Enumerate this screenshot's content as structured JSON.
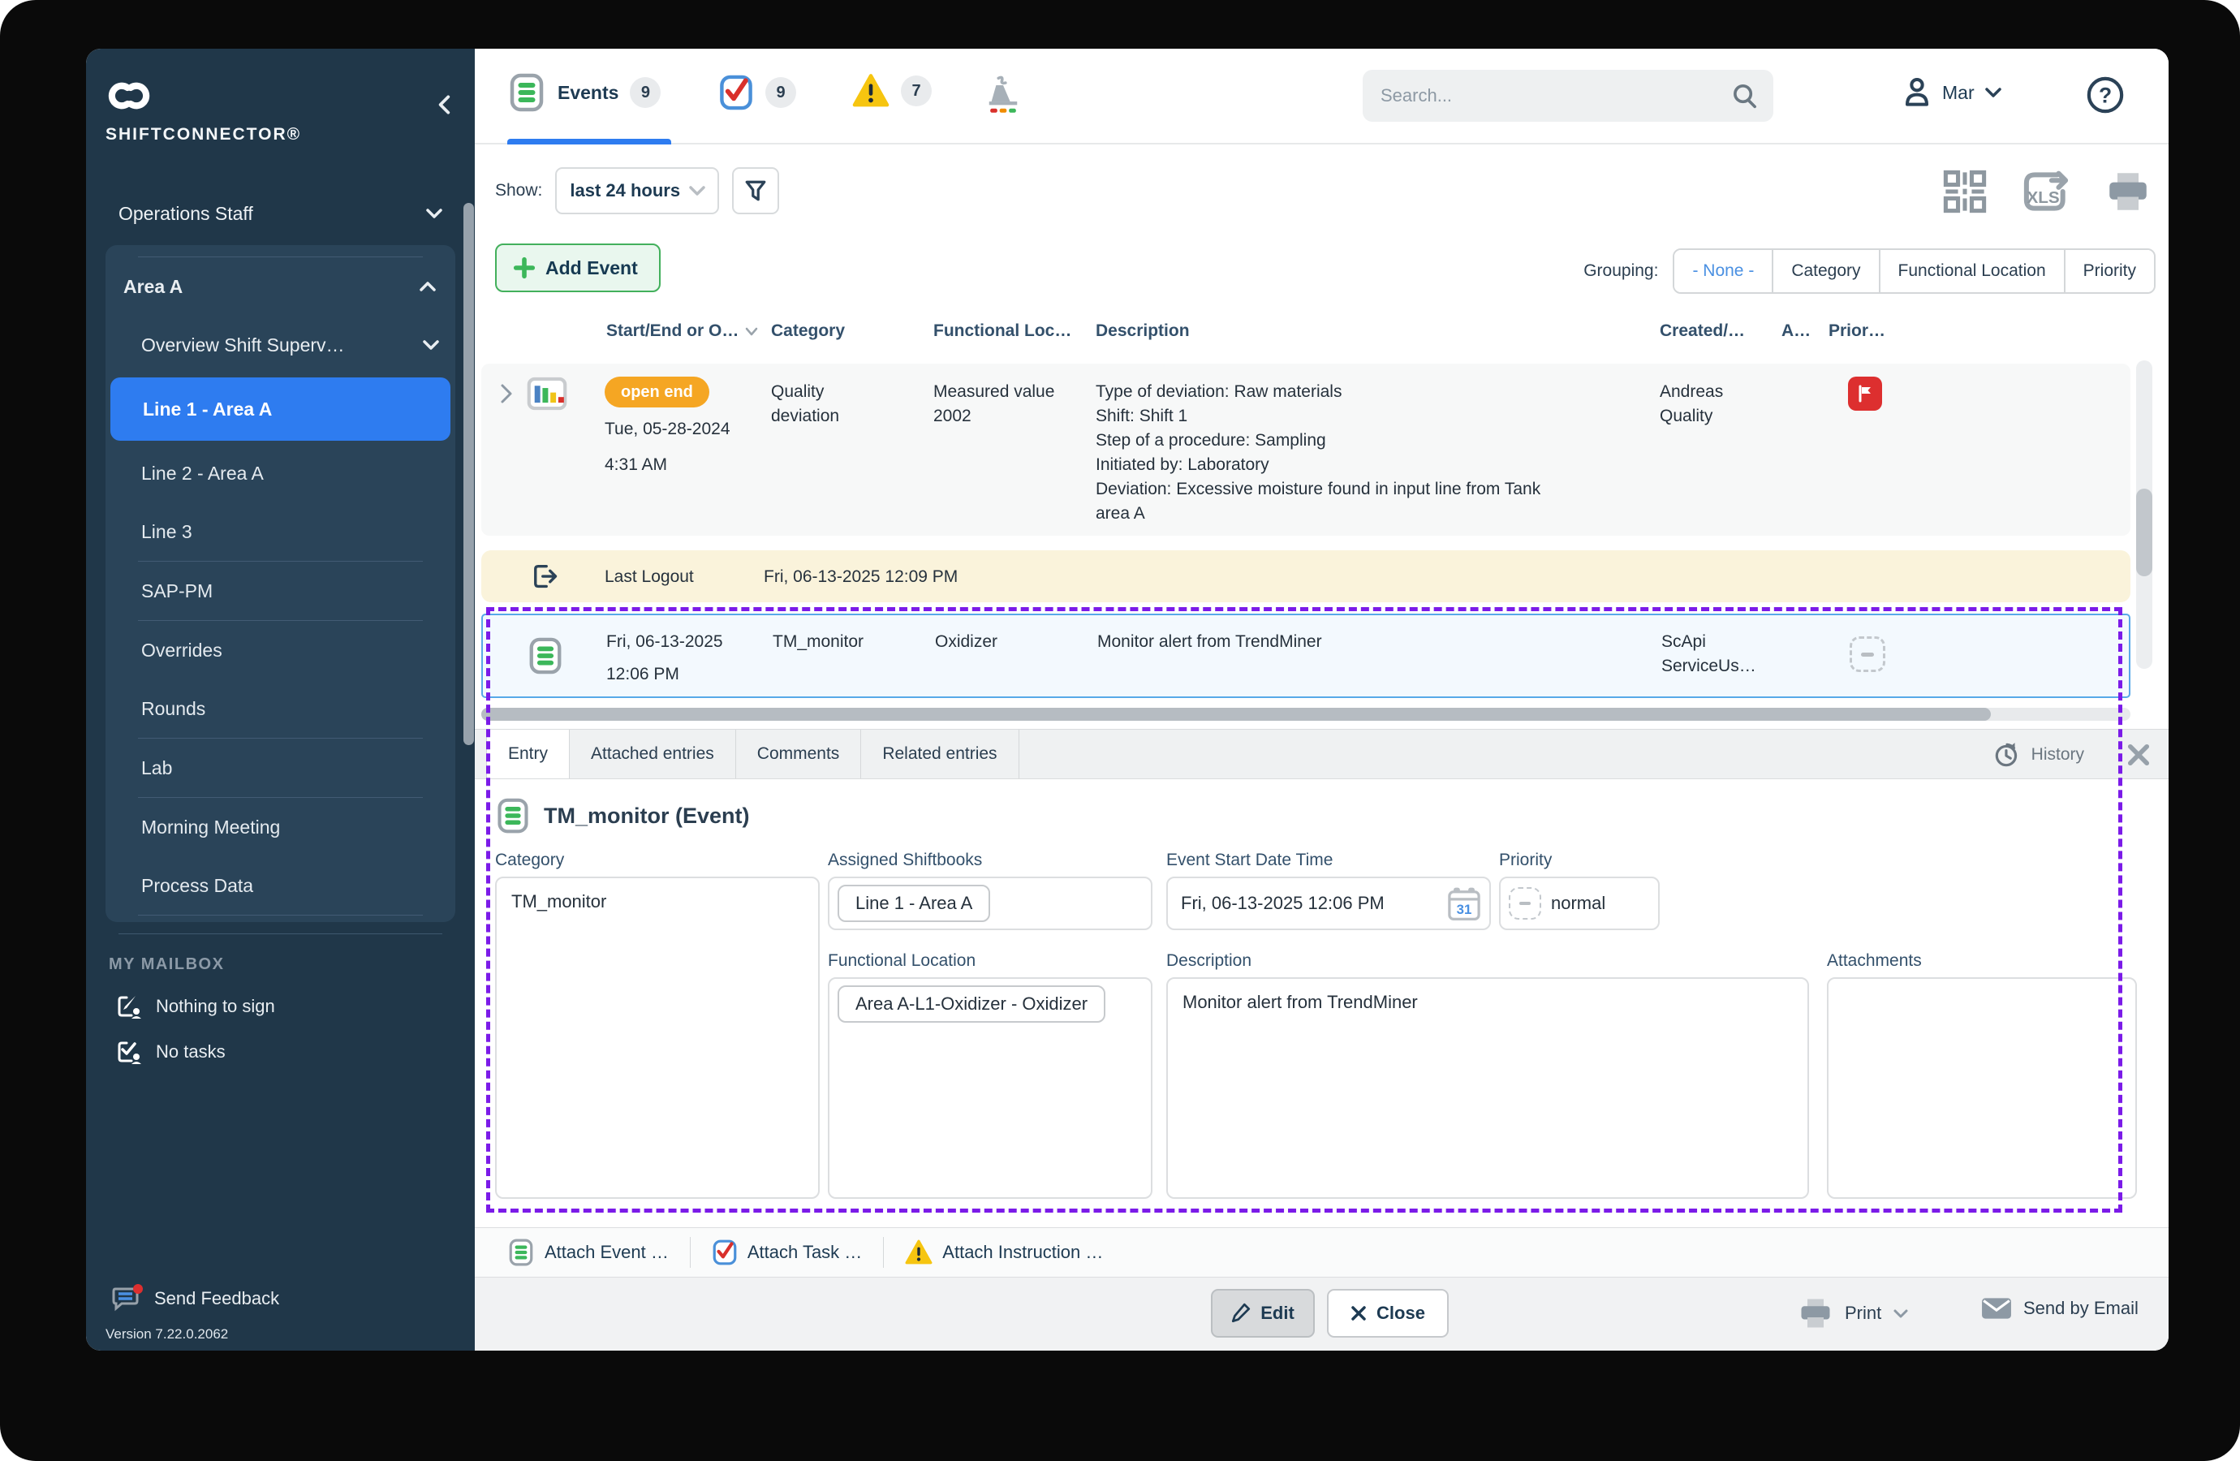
{
  "colors": {
    "sidebar_navy": "#203749",
    "panel_navy": "#2a4459",
    "accent_blue": "#2e7cf0",
    "selection_purple": "#7b1be8",
    "pill_orange": "#f5a623",
    "logout_cream": "#faf3db",
    "selected_row_blue": "#f3f9fe",
    "green": "#3cb75a",
    "warning_yellow": "#f6c510",
    "flag_red": "#dd2f2f",
    "header_text": "#33506b"
  },
  "sidebar": {
    "brand": "SHIFTCONNECTOR®",
    "groups": {
      "operations": "Operations Staff",
      "area": "Area A",
      "overview": "Overview Shift Superv…"
    },
    "items": {
      "line1": "Line 1 - Area A",
      "line2": "Line 2 - Area A",
      "line3": "Line 3",
      "sap": "SAP-PM",
      "overrides": "Overrides",
      "rounds": "Rounds",
      "lab": "Lab",
      "morning": "Morning Meeting",
      "process": "Process Data"
    },
    "mailbox": {
      "header": "MY MAILBOX",
      "sign": "Nothing to sign",
      "tasks": "No tasks"
    },
    "feedback": "Send Feedback",
    "version": "Version 7.22.0.2062"
  },
  "topbar": {
    "events_label": "Events",
    "events_count": "9",
    "tasks_count": "9",
    "warnings_count": "7",
    "search_placeholder": "Search...",
    "user_name": "Mar"
  },
  "toolbar": {
    "show_label": "Show:",
    "show_value": "last 24 hours",
    "add_event_label": "Add Event",
    "grouping_label": "Grouping:",
    "grouping": {
      "none": "- None -",
      "category": "Category",
      "functional_location": "Functional Location",
      "priority": "Priority"
    }
  },
  "table": {
    "columns": {
      "start": "Start/End or O…",
      "category": "Category",
      "functional_location": "Functional Loc…",
      "description": "Description",
      "created": "Created/…",
      "a": "A…",
      "priority": "Prior…"
    },
    "row1": {
      "status": "open end",
      "date": "Tue, 05-28-2024",
      "time": "4:31 AM",
      "category": "Quality deviation",
      "functional_location": "Measured value 2002",
      "description": "Type of deviation: Raw materials\nShift: Shift 1\nStep of a procedure: Sampling\nInitiated by: Laboratory\nDeviation: Excessive moisture found in input line from Tank\narea A",
      "created": "Andreas Quality"
    },
    "logout_row": {
      "label": "Last Logout",
      "datetime": "Fri, 06-13-2025 12:09 PM"
    },
    "selected_row": {
      "date": "Fri, 06-13-2025",
      "time": "12:06 PM",
      "category": "TM_monitor",
      "functional_location": "Oxidizer",
      "description": "Monitor alert from TrendMiner",
      "created": "ScApi ServiceUs…"
    }
  },
  "detail": {
    "tabs": {
      "entry": "Entry",
      "attached": "Attached entries",
      "comments": "Comments",
      "related": "Related entries"
    },
    "history_label": "History",
    "title": "TM_monitor (Event)",
    "category_label": "Category",
    "category_value": "TM_monitor",
    "shiftbooks_label": "Assigned Shiftbooks",
    "shiftbooks_value": "Line 1 - Area A",
    "start_label": "Event Start Date Time",
    "start_value": "Fri, 06-13-2025 12:06 PM",
    "calendar_day": "31",
    "priority_label": "Priority",
    "priority_value": "normal",
    "funcloc_label": "Functional Location",
    "funcloc_value": "Area A-L1-Oxidizer - Oxidizer",
    "description_label": "Description",
    "description_value": "Monitor alert from TrendMiner",
    "attachments_label": "Attachments"
  },
  "footer": {
    "attach_event": "Attach Event …",
    "attach_task": "Attach Task …",
    "attach_instruction": "Attach Instruction …",
    "edit": "Edit",
    "close": "Close",
    "print": "Print",
    "send_email": "Send by Email"
  }
}
